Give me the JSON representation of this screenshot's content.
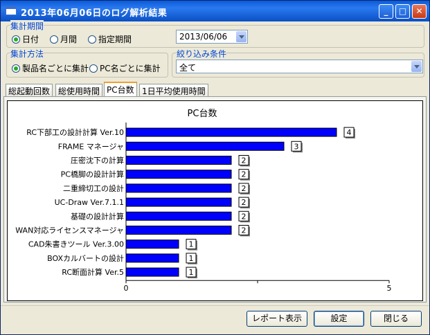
{
  "window": {
    "title": "2013年06月06日のログ解析結果"
  },
  "period_group": {
    "label": "集計期間",
    "options": [
      {
        "label": "日付",
        "selected": true
      },
      {
        "label": "月間",
        "selected": false
      },
      {
        "label": "指定期間",
        "selected": false
      }
    ],
    "date_value": "2013/06/06"
  },
  "method_group": {
    "label": "集計方法",
    "options": [
      {
        "label": "製品名ごとに集計",
        "selected": true
      },
      {
        "label": "PC名ごとに集計",
        "selected": false
      }
    ]
  },
  "filter_group": {
    "label": "絞り込み条件",
    "value": "全て"
  },
  "tabs": [
    {
      "label": "総起動回数",
      "active": false
    },
    {
      "label": "総使用時間",
      "active": false
    },
    {
      "label": "PC台数",
      "active": true
    },
    {
      "label": "1日平均使用時間",
      "active": false
    }
  ],
  "chart_data": {
    "type": "bar",
    "orientation": "horizontal",
    "title": "PC台数",
    "categories": [
      "RC下部工の設計計算 Ver.10",
      "FRAME マネージャ",
      "圧密沈下の計算",
      "PC橋脚の設計計算",
      "二重締切工の設計",
      "UC-Draw Ver.7.1.1",
      "基礎の設計計算",
      "WAN対応ライセンスマネージャ",
      "CAD朱書きツール Ver.3.00",
      "BOXカルバートの設計",
      "RC断面計算 Ver.5"
    ],
    "values": [
      4,
      3,
      2,
      2,
      2,
      2,
      2,
      2,
      1,
      1,
      1
    ],
    "data_labels": [
      "4",
      "3",
      "2",
      "2",
      "2",
      "2",
      "2",
      "2",
      "1",
      "1",
      "1"
    ],
    "xlim": [
      0,
      5
    ],
    "xticks": [
      "0",
      "5"
    ],
    "bar_color": "#0000ff",
    "grid": false,
    "legend": "none"
  },
  "buttons": {
    "report": "レポート表示",
    "settings": "設定",
    "close": "閉じる"
  }
}
